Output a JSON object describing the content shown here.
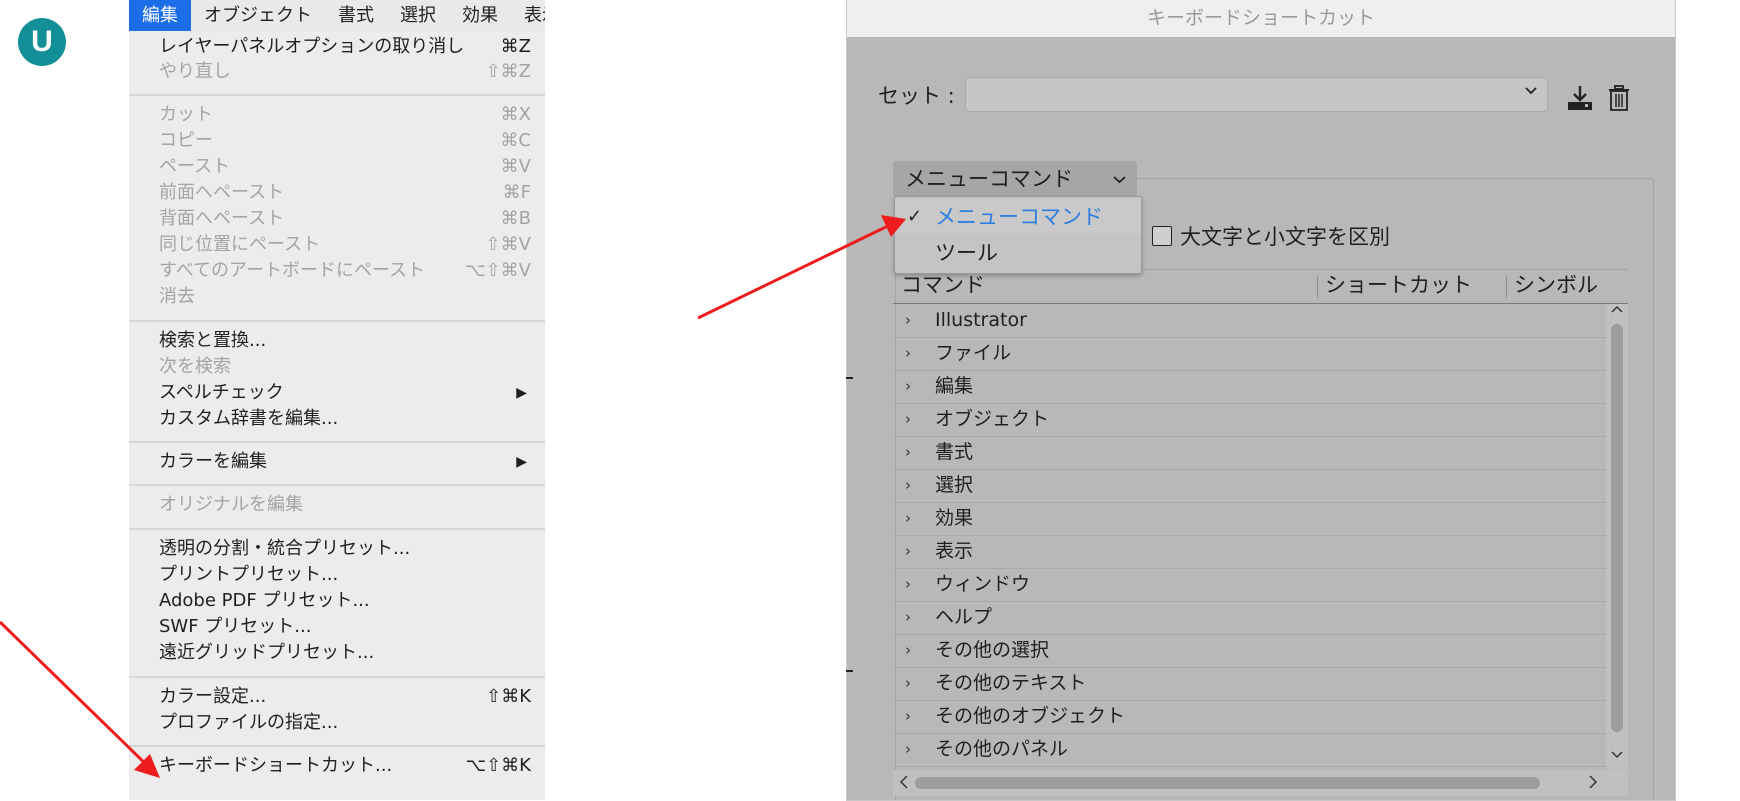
{
  "logo": {
    "letter": "U",
    "color": "#138f98"
  },
  "menubar": {
    "items": [
      "編集",
      "オブジェクト",
      "書式",
      "選択",
      "効果",
      "表示"
    ],
    "active_index": 0,
    "active_color": "#1c6ee8"
  },
  "edit_menu": {
    "items": [
      {
        "label": "レイヤーパネルオプションの取り消し",
        "shortcut": "⌘Z",
        "disabled": false
      },
      {
        "label": "やり直し",
        "shortcut": "⇧⌘Z",
        "disabled": true
      },
      {
        "label": "カット",
        "shortcut": "⌘X",
        "disabled": true
      },
      {
        "label": "コピー",
        "shortcut": "⌘C",
        "disabled": true
      },
      {
        "label": "ペースト",
        "shortcut": "⌘V",
        "disabled": true
      },
      {
        "label": "前面へペースト",
        "shortcut": "⌘F",
        "disabled": true
      },
      {
        "label": "背面へペースト",
        "shortcut": "⌘B",
        "disabled": true
      },
      {
        "label": "同じ位置にペースト",
        "shortcut": "⇧⌘V",
        "disabled": true
      },
      {
        "label": "すべてのアートボードにペースト",
        "shortcut": "⌥⇧⌘V",
        "disabled": true
      },
      {
        "label": "消去",
        "shortcut": "",
        "disabled": true
      },
      {
        "label": "検索と置換...",
        "shortcut": "",
        "disabled": false
      },
      {
        "label": "次を検索",
        "shortcut": "",
        "disabled": true
      },
      {
        "label": "スペルチェック",
        "shortcut": "",
        "disabled": false,
        "submenu": true
      },
      {
        "label": "カスタム辞書を編集...",
        "shortcut": "",
        "disabled": false
      },
      {
        "label": "カラーを編集",
        "shortcut": "",
        "disabled": false,
        "submenu": true
      },
      {
        "label": "オリジナルを編集",
        "shortcut": "",
        "disabled": true
      },
      {
        "label": "透明の分割・統合プリセット...",
        "shortcut": "",
        "disabled": false
      },
      {
        "label": "プリントプリセット...",
        "shortcut": "",
        "disabled": false
      },
      {
        "label": "Adobe PDF プリセット...",
        "shortcut": "",
        "disabled": false
      },
      {
        "label": "SWF プリセット...",
        "shortcut": "",
        "disabled": false
      },
      {
        "label": "遠近グリッドプリセット...",
        "shortcut": "",
        "disabled": false
      },
      {
        "label": "カラー設定...",
        "shortcut": "⇧⌘K",
        "disabled": false
      },
      {
        "label": "プロファイルの指定...",
        "shortcut": "",
        "disabled": false
      },
      {
        "label": "キーボードショートカット...",
        "shortcut": "⌥⇧⌘K",
        "disabled": false
      }
    ],
    "submenu_arrow": "▶"
  },
  "dialog": {
    "title": "キーボードショートカット",
    "set_label": "セット :",
    "set_value": "",
    "command_type": "メニューコマンド",
    "command_type_options": [
      "メニューコマンド",
      "ツール"
    ],
    "case_sensitive_label": "大文字と小文字を区別",
    "columns": [
      "コマンド",
      "ショートカット",
      "シンボル"
    ],
    "rows": [
      "Illustrator",
      "ファイル",
      "編集",
      "オブジェクト",
      "書式",
      "選択",
      "効果",
      "表示",
      "ウィンドウ",
      "ヘルプ",
      "その他の選択",
      "その他のテキスト",
      "その他のオブジェクト",
      "その他のパネル"
    ],
    "selected_option_color": "#2f7fe0"
  },
  "icons": {
    "download": "download-icon",
    "trash": "trash-icon",
    "chevron": "chevron-down-icon",
    "row_chevron": "›",
    "check": "✓"
  },
  "annotation_color": "#ee1c1c"
}
